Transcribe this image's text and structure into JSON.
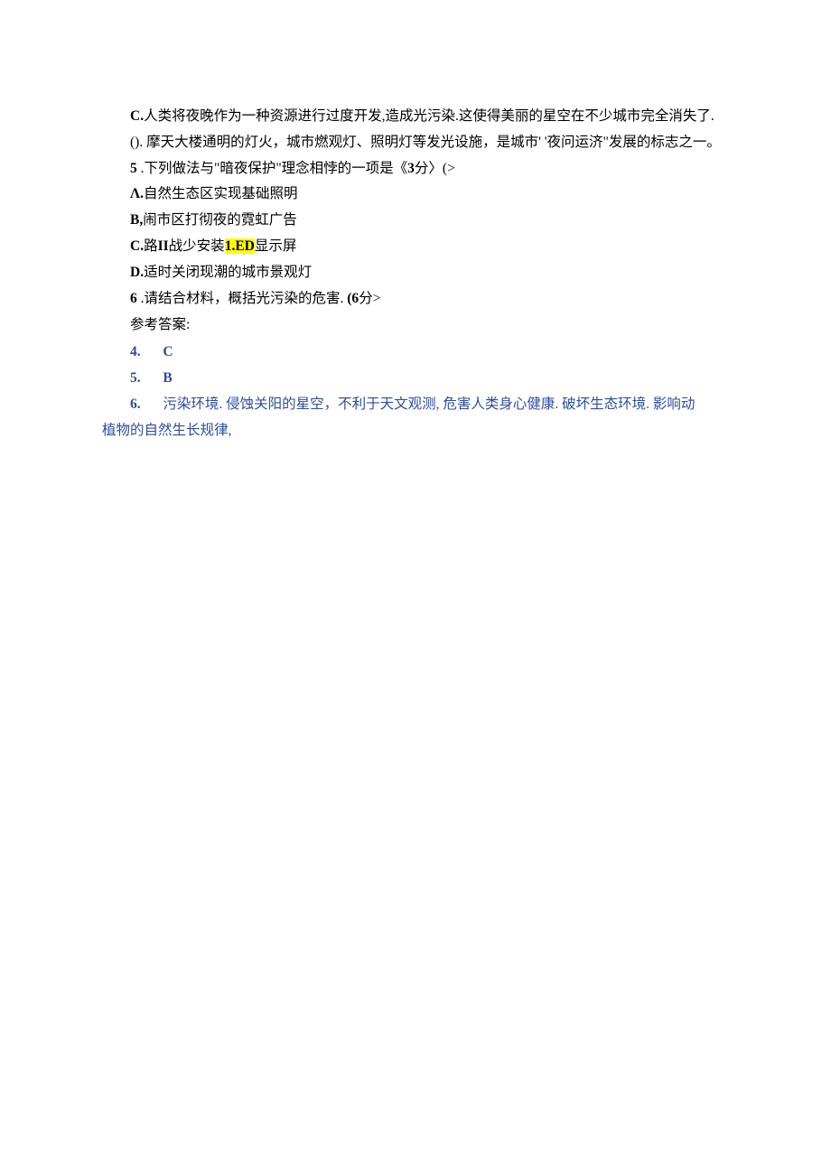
{
  "p_c": "C.人类将夜晚作为一种资源进行过度开发,造成光污染.这使得美丽的星空在不少城市完全消失了.",
  "p_d": "(). 摩天大楼通明的灯火，城市燃观灯、照明灯等发光设施，是城市'  '夜问运济\"发展的标志之一。",
  "q5": {
    "num": "5",
    "text": " .下列做法与\"暗夜保护\"理念相悖的一项是《",
    "mark_bold": "3",
    "mark_tail": "分〉(>",
    "a": "Λ.自然生态区实现基础照明",
    "b_bold": "B,",
    "b_text": "闹市区打彻夜的霓虹广告",
    "c_bold1": "C.",
    "c_text1": "路",
    "c_bold2": "II",
    "c_text2": "战少安装",
    "c_hl": "1.ED",
    "c_text3": "显示屏",
    "d_bold": "D.",
    "d_text": "适时关闭现潮的城市景观灯"
  },
  "q6": {
    "num": "6",
    "text": " .请结合材料，概括光污染的危害. ",
    "mark_bold": "(6",
    "mark_tail": "分>"
  },
  "ans_label": "参考答案:",
  "ans4_num": "4.",
  "ans4_val": "C",
  "ans5_num": "5.",
  "ans5_val": "B",
  "ans6_num": "6.",
  "ans6_text_a": "污染环境. 侵蚀关阳的星空，不利于天文观测, 危害人类身心健康. 破坏生态环境. 影响动",
  "ans6_text_b": "植物的自然生长规律,"
}
